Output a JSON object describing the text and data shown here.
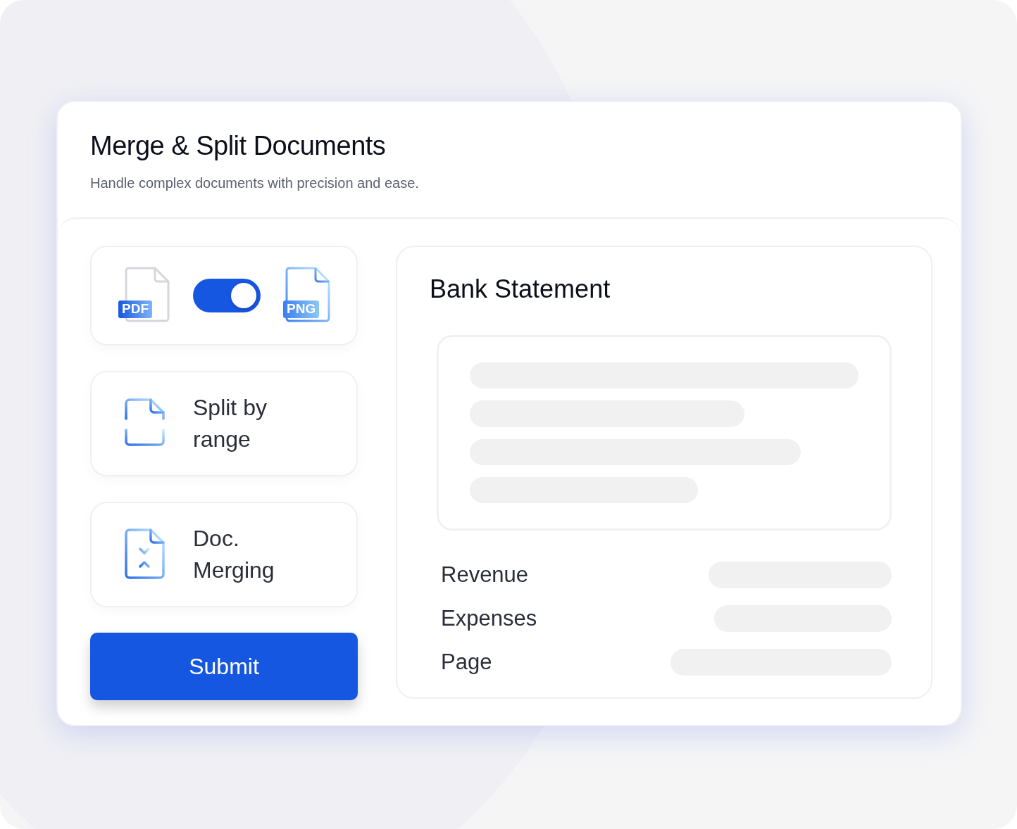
{
  "header": {
    "title": "Merge & Split Documents",
    "subtitle": "Handle complex documents with precision and ease."
  },
  "converter": {
    "from_label": "PDF",
    "to_label": "PNG",
    "on": true
  },
  "options": [
    {
      "kind": "split",
      "label": "Split by range"
    },
    {
      "kind": "merge",
      "label": "Doc. Merging"
    }
  ],
  "submit": {
    "label": "Submit"
  },
  "preview": {
    "title": "Bank Statement",
    "fields": [
      {
        "label": "Revenue"
      },
      {
        "label": "Expenses"
      },
      {
        "label": "Page"
      }
    ]
  }
}
